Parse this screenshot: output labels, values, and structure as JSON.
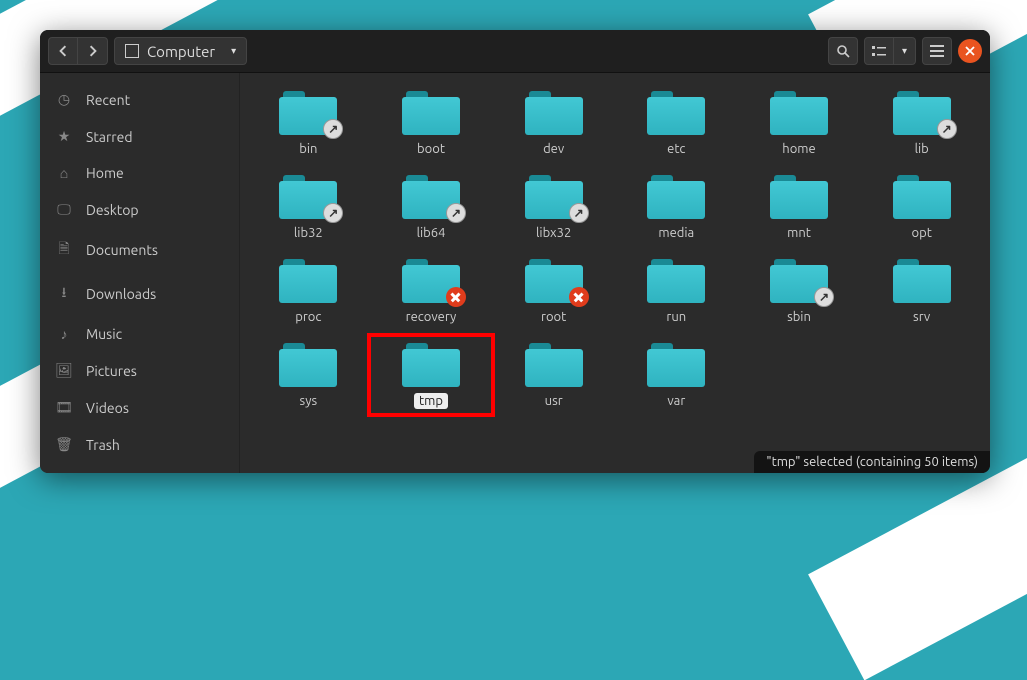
{
  "titlebar": {
    "path_label": "Computer"
  },
  "sidebar": {
    "items": [
      {
        "icon": "clock-icon",
        "glyph": "◷",
        "label": "Recent"
      },
      {
        "icon": "star-icon",
        "glyph": "★",
        "label": "Starred"
      },
      {
        "icon": "home-icon",
        "glyph": "⌂",
        "label": "Home"
      },
      {
        "icon": "desktop-icon",
        "glyph": "🖵",
        "label": "Desktop"
      },
      {
        "icon": "documents-icon",
        "glyph": "🗎",
        "label": "Documents"
      },
      {
        "icon": "downloads-icon",
        "glyph": "⭳",
        "label": "Downloads"
      },
      {
        "icon": "music-icon",
        "glyph": "♪",
        "label": "Music"
      },
      {
        "icon": "pictures-icon",
        "glyph": "🖼",
        "label": "Pictures"
      },
      {
        "icon": "videos-icon",
        "glyph": "🎞",
        "label": "Videos"
      },
      {
        "icon": "trash-icon",
        "glyph": "🗑",
        "label": "Trash"
      }
    ]
  },
  "folders": [
    {
      "name": "bin",
      "emblem": "link"
    },
    {
      "name": "boot",
      "emblem": null
    },
    {
      "name": "dev",
      "emblem": null
    },
    {
      "name": "etc",
      "emblem": null
    },
    {
      "name": "home",
      "emblem": null
    },
    {
      "name": "lib",
      "emblem": "link"
    },
    {
      "name": "lib32",
      "emblem": "link"
    },
    {
      "name": "lib64",
      "emblem": "link"
    },
    {
      "name": "libx32",
      "emblem": "link"
    },
    {
      "name": "media",
      "emblem": null
    },
    {
      "name": "mnt",
      "emblem": null
    },
    {
      "name": "opt",
      "emblem": null
    },
    {
      "name": "proc",
      "emblem": null
    },
    {
      "name": "recovery",
      "emblem": "denied"
    },
    {
      "name": "root",
      "emblem": "denied"
    },
    {
      "name": "run",
      "emblem": null
    },
    {
      "name": "sbin",
      "emblem": "link"
    },
    {
      "name": "srv",
      "emblem": null
    },
    {
      "name": "sys",
      "emblem": null
    },
    {
      "name": "tmp",
      "emblem": null,
      "selected": true,
      "highlighted": true
    },
    {
      "name": "usr",
      "emblem": null
    },
    {
      "name": "var",
      "emblem": null
    }
  ],
  "status": "\"tmp\" selected  (containing 50 items)"
}
